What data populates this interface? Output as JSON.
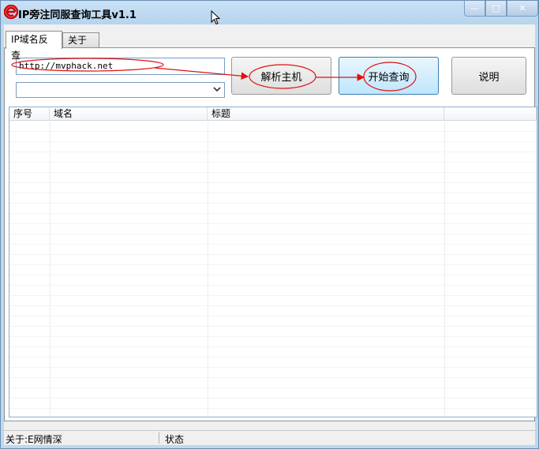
{
  "window": {
    "title": "IP旁注同服查询工具v1.1",
    "controls": {
      "minimize": "—",
      "maximize": "□",
      "close": "✕"
    }
  },
  "tabs": [
    {
      "label": "IP域名反查",
      "active": true
    },
    {
      "label": "关于",
      "active": false
    }
  ],
  "form": {
    "url_value": "http://mvphack.net",
    "combo_value": "",
    "parse_button": "解析主机",
    "query_button": "开始查询",
    "help_button": "说明"
  },
  "table": {
    "columns": [
      "序号",
      "域名",
      "标题",
      ""
    ],
    "rows": []
  },
  "statusbar": {
    "about": "关于:E网情深",
    "status": "状态"
  },
  "colors": {
    "annotation": "#e01010",
    "accent": "#3c7fb1",
    "icon_red": "#d40000"
  },
  "icons": {
    "app": "app-e-logo-icon",
    "cursor": "mouse-pointer-icon",
    "dropdown": "chevron-down-icon"
  }
}
